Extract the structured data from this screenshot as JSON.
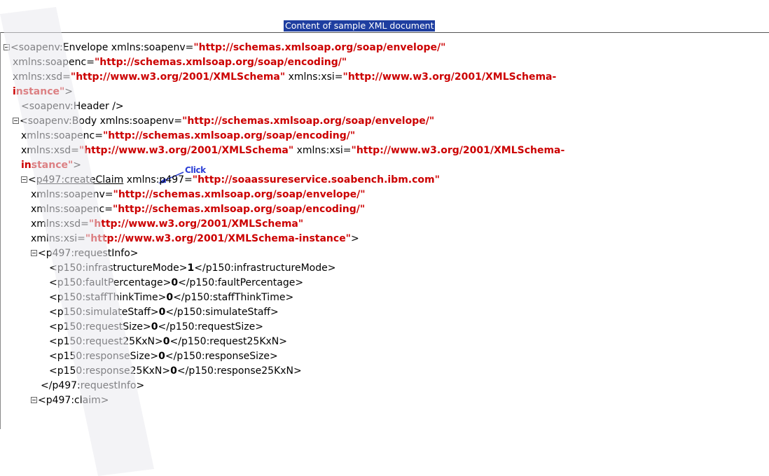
{
  "header": {
    "title": "Content of sample XML document"
  },
  "annotation": {
    "click_label": "Click"
  },
  "xml": {
    "l1_tag": "<soapenv:Envelope",
    "l1_attr1": " xmlns:soapenv=",
    "l1_val1": "\"http://schemas.xmlsoap.org/soap/envelope/\"",
    "l2_attr": "xmlns:soapenc=",
    "l2_val": "\"http://schemas.xmlsoap.org/soap/encoding/\"",
    "l3_attr1": "xmlns:xsd=",
    "l3_val1": "\"http://www.w3.org/2001/XMLSchema\"",
    "l3_attr2": " xmlns:xsi=",
    "l3_val2": "\"http://www.w3.org/2001/XMLSchema-",
    "l4_val": "instance\"",
    "l4_close": ">",
    "header_tag": "<soapenv:Header />",
    "body_tag": "<soapenv:Body",
    "body_attr1": " xmlns:soapenv=",
    "body_val1": "\"http://schemas.xmlsoap.org/soap/envelope/\"",
    "body_l2_attr": "xmlns:soapenc=",
    "body_l2_val": "\"http://schemas.xmlsoap.org/soap/encoding/\"",
    "body_l3_attr1": "xmlns:xsd=",
    "body_l3_val1": "\"http://www.w3.org/2001/XMLSchema\"",
    "body_l3_attr2": " xmlns:xsi=",
    "body_l3_val2": "\"http://www.w3.org/2001/XMLSchema-",
    "body_l4_val": "instance\"",
    "body_l4_close": ">",
    "cc_open": "<",
    "cc_link": "p497:createClaim",
    "cc_attr1": " xmlns:p497=",
    "cc_val1": "\"http://soaassureservice.soabench.ibm.com\"",
    "cc_l2_attr": "xmlns:soapenv=",
    "cc_l2_val": "\"http://schemas.xmlsoap.org/soap/envelope/\"",
    "cc_l3_attr": "xmlns:soapenc=",
    "cc_l3_val": "\"http://schemas.xmlsoap.org/soap/encoding/\"",
    "cc_l4_attr": "xmlns:xsd=",
    "cc_l4_val": "\"http://www.w3.org/2001/XMLSchema\"",
    "cc_l5_attr": "xmlns:xsi=",
    "cc_l5_val": "\"http://www.w3.org/2001/XMLSchema-instance\"",
    "cc_l5_close": ">",
    "ri_open": "<p497:requestInfo>",
    "ri_close": "</p497:requestInfo>",
    "claim_open": "<p497:claim>",
    "fields": [
      {
        "open": "<p150:infrastructureMode>",
        "value": "1",
        "close": "</p150:infrastructureMode>"
      },
      {
        "open": "<p150:faultPercentage>",
        "value": "0",
        "close": "</p150:faultPercentage>"
      },
      {
        "open": "<p150:staffThinkTime>",
        "value": "0",
        "close": "</p150:staffThinkTime>"
      },
      {
        "open": "<p150:simulateStaff>",
        "value": "0",
        "close": "</p150:simulateStaff>"
      },
      {
        "open": "<p150:requestSize>",
        "value": "0",
        "close": "</p150:requestSize>"
      },
      {
        "open": "<p150:request25KxN>",
        "value": "0",
        "close": "</p150:request25KxN>"
      },
      {
        "open": "<p150:responseSize>",
        "value": "0",
        "close": "</p150:responseSize>"
      },
      {
        "open": "<p150:response25KxN>",
        "value": "0",
        "close": "</p150:response25KxN>"
      }
    ]
  }
}
